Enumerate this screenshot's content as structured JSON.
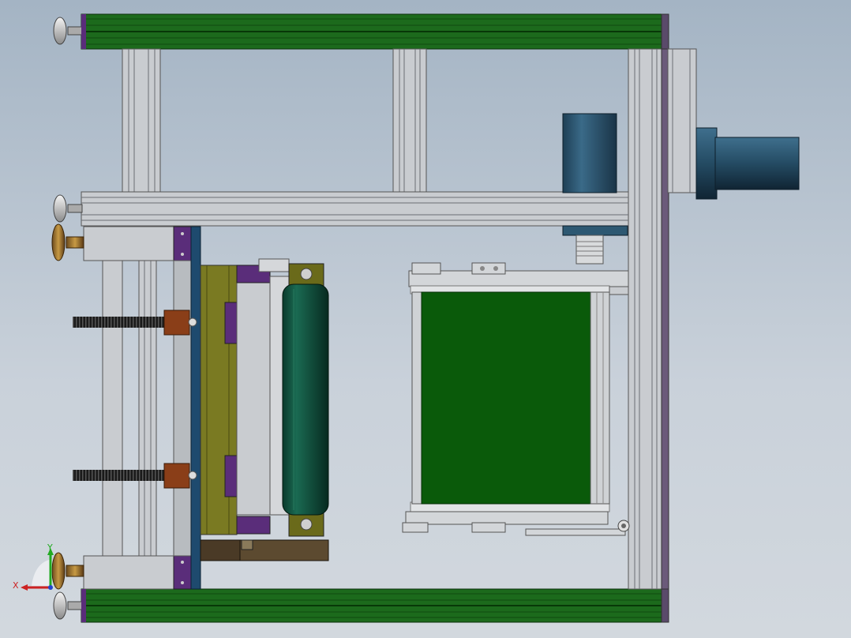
{
  "viewport": {
    "background_top": "#a4b4c4",
    "background_bottom": "#d2d8de"
  },
  "colors": {
    "extrusion_green": "#1c6a1c",
    "extrusion_dark": "#0f4a0f",
    "aluminum": "#c9ccd0",
    "aluminum_dark": "#8e9297",
    "motor_blue": "#2d5872",
    "roller_green": "#0f4d3a",
    "belt_green": "#0a5a0a",
    "plate_olive": "#7a7a22",
    "purple_block": "#5a2d7a",
    "nut_brown": "#8a3e18",
    "plate_blue": "#1e4a6e",
    "base_brown": "#4a3a26"
  },
  "triad": {
    "x_label": "X",
    "y_label": "Y",
    "x_color": "#cc2222",
    "y_color": "#22aa22",
    "z_color": "#2244cc"
  }
}
